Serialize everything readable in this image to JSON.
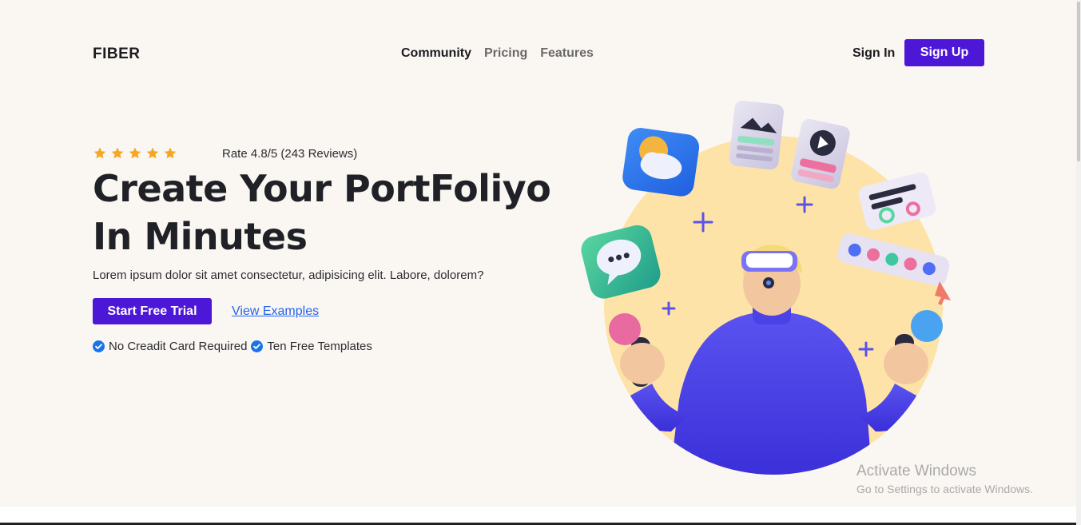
{
  "header": {
    "logo": "FIBER",
    "nav": [
      {
        "label": "Community",
        "active": true
      },
      {
        "label": "Pricing",
        "active": false
      },
      {
        "label": "Features",
        "active": false
      }
    ],
    "sign_in": "Sign In",
    "sign_up": "Sign Up"
  },
  "hero": {
    "stars": 5,
    "rating_text": "Rate 4.8/5 (243 Reviews)",
    "title_line1": "Create Your PortFoliyo",
    "title_line2": "In Minutes",
    "description": "Lorem ipsum dolor sit amet consectetur, adipisicing elit. Labore, dolorem?",
    "cta_label": "Start Free Trial",
    "secondary_link": "View Examples",
    "features": [
      "No Creadit Card Required",
      "Ten Free Templates"
    ]
  },
  "watermark": {
    "title": "Activate Windows",
    "subtitle": "Go to Settings to activate Windows."
  },
  "colors": {
    "accent": "#4c17d6",
    "star": "#f5a623",
    "check": "#1a73e8",
    "circle": "#fde3a7",
    "background": "#faf7f3"
  }
}
